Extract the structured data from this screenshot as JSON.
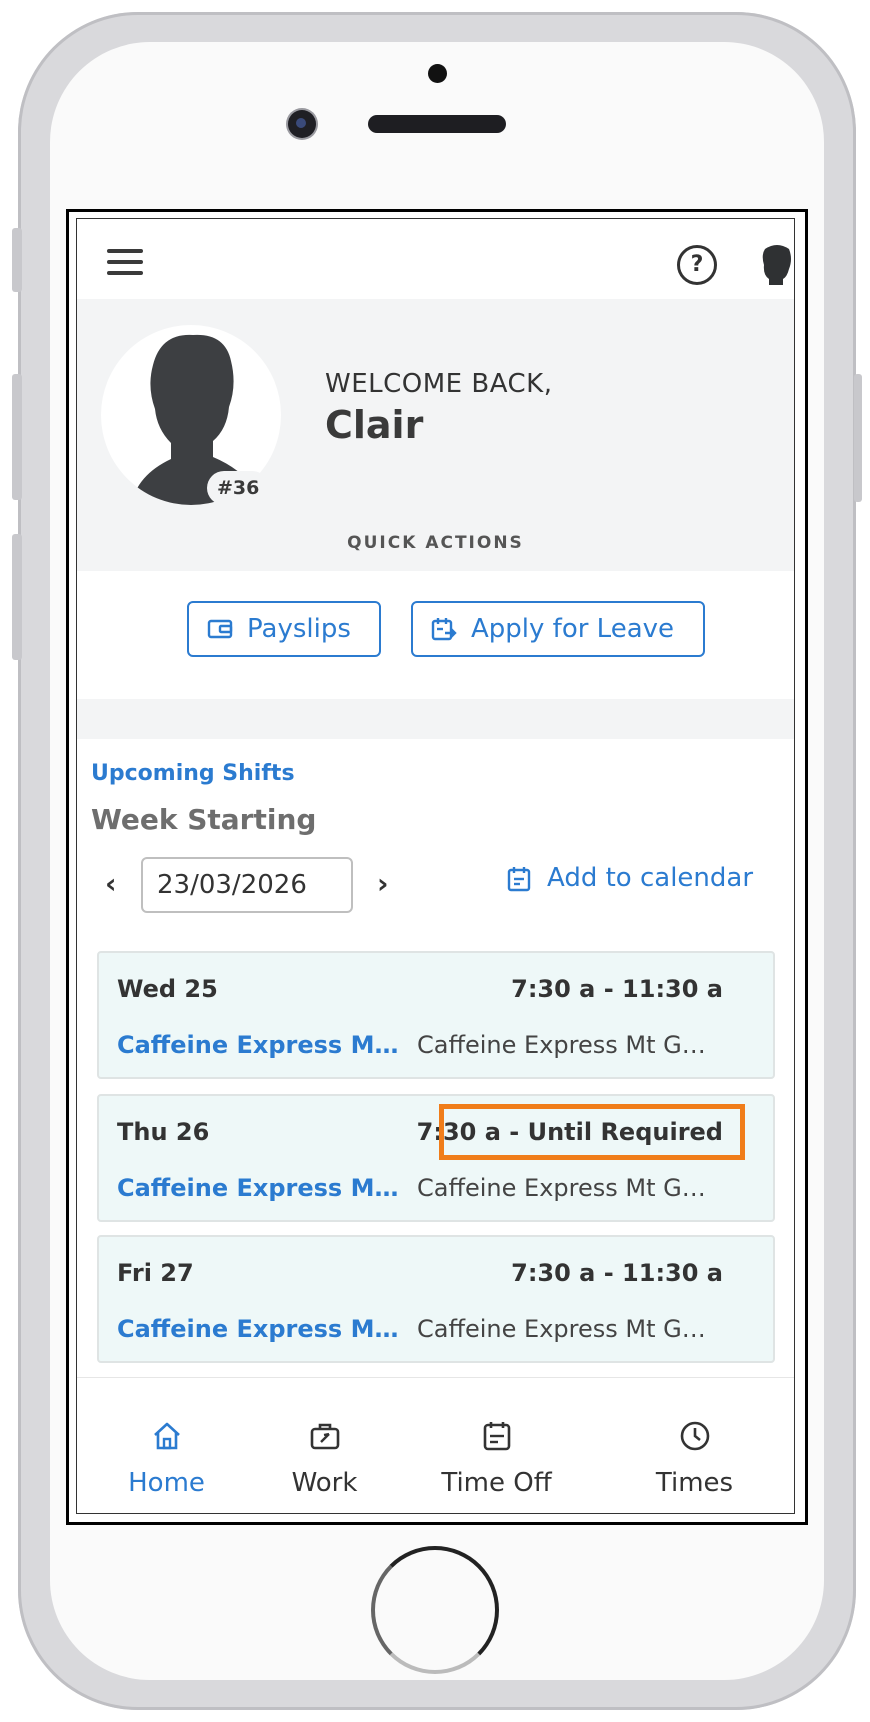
{
  "header": {
    "menu_icon": "hamburger-icon",
    "help_icon": "help-circle-icon",
    "avatar_icon": "user-silhouette-icon"
  },
  "welcome": {
    "label": "WELCOME BACK,",
    "name": "Clair",
    "badge": "#36",
    "quick_actions_label": "QUICK ACTIONS"
  },
  "quick_actions": {
    "payslips": "Payslips",
    "apply_leave": "Apply for Leave"
  },
  "shifts_section": {
    "title": "Upcoming Shifts",
    "week_label": "Week Starting",
    "date_value": "23/03/2026",
    "prev": "‹",
    "next": "›",
    "add_calendar": "Add to calendar"
  },
  "shifts": [
    {
      "day": "Wed 25",
      "time": "7:30 a - 11:30 a",
      "location": "Caffeine Express Mt Gravatt",
      "sublocation": "Caffeine Express Mt Gravatt"
    },
    {
      "day": "Thu 26",
      "time": "7:30 a - Until Required",
      "location": "Caffeine Express Mt Gravatt",
      "sublocation": "Caffeine Express Mt Gravatt"
    },
    {
      "day": "Fri 27",
      "time": "7:30 a - 11:30 a",
      "location": "Caffeine Express Mt Gravatt",
      "sublocation": "Caffeine Express Mt Gravatt"
    }
  ],
  "nav": {
    "home": "Home",
    "work": "Work",
    "time_off": "Time Off",
    "times": "Times"
  },
  "colors": {
    "accent": "#2b7bd0",
    "highlight": "#f07d1a",
    "shift_bg": "#eef8f8"
  }
}
